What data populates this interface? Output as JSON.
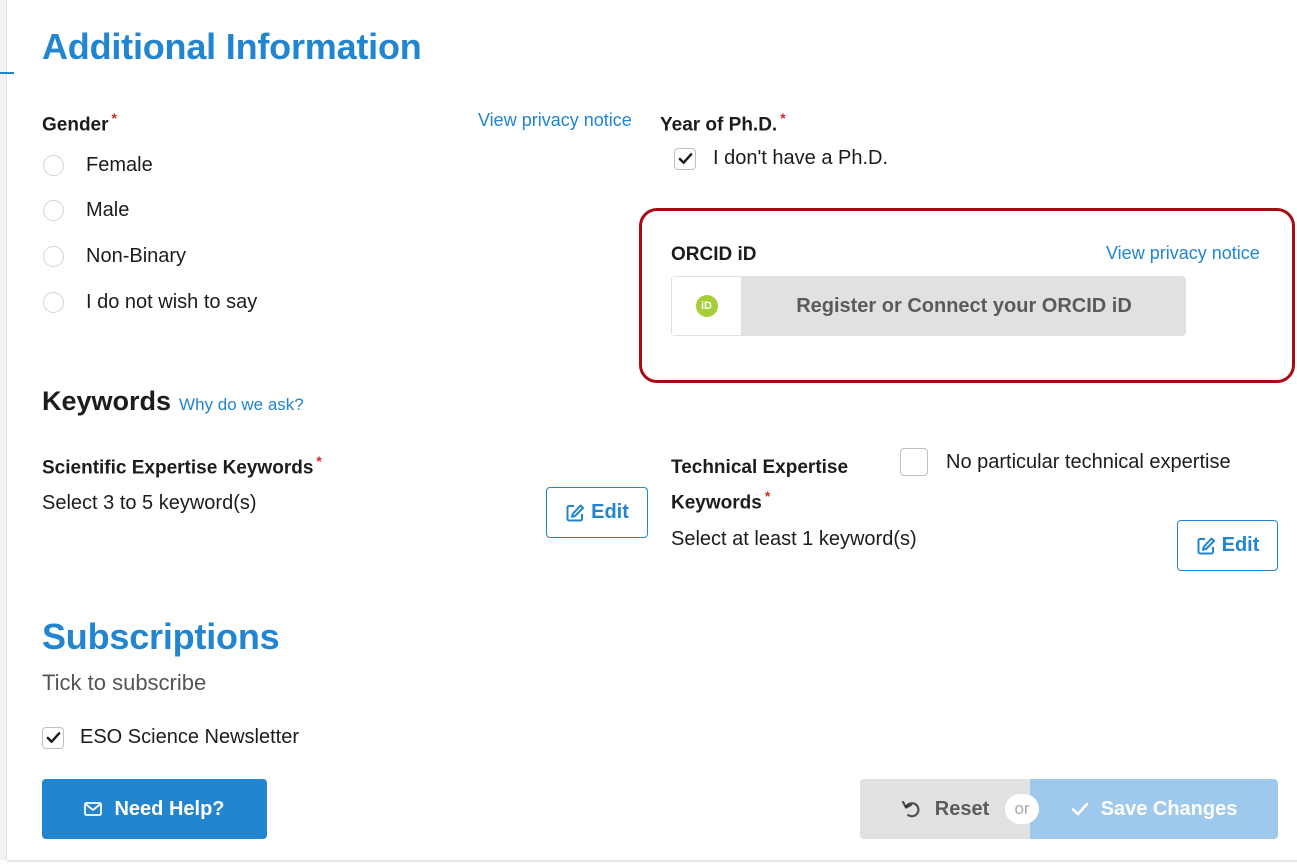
{
  "sections": {
    "additional_info": "Additional Information",
    "subscriptions": "Subscriptions"
  },
  "gender": {
    "label": "Gender",
    "required": "*",
    "privacy_link": "View privacy notice",
    "options": [
      "Female",
      "Male",
      "Non-Binary",
      "I do not wish to say"
    ]
  },
  "phd": {
    "label": "Year of Ph.D.",
    "required": "*",
    "no_phd_label": "I don't have a Ph.D.",
    "no_phd_checked": true
  },
  "orcid": {
    "label": "ORCID iD",
    "privacy_link": "View privacy notice",
    "icon_text": "iD",
    "button_label": "Register or Connect your ORCID iD"
  },
  "keywords": {
    "title": "Keywords",
    "why_link": "Why do we ask?",
    "scientific": {
      "label": "Scientific Expertise Keywords",
      "required": "*",
      "hint": "Select 3 to 5 keyword(s)",
      "edit_label": "Edit"
    },
    "technical": {
      "label_line1": "Technical Expertise",
      "label_line2": "Keywords",
      "required": "*",
      "hint": "Select at least 1 keyword(s)",
      "edit_label": "Edit",
      "none_label": "No particular technical expertise",
      "none_checked": false
    }
  },
  "subscriptions": {
    "subtitle": "Tick to subscribe",
    "newsletter_label": "ESO Science Newsletter",
    "newsletter_checked": true
  },
  "actions": {
    "help_label": "Need Help?",
    "reset_label": "Reset",
    "or_label": "or",
    "save_label": "Save Changes"
  },
  "icons": {
    "help": "envelope-icon",
    "reset": "undo-icon",
    "save": "check-icon",
    "edit": "edit-icon",
    "orcid": "orcid-icon"
  },
  "colors": {
    "accent": "#2185d0",
    "required": "#db2828",
    "highlight_frame": "#a60b16",
    "orcid_green": "#a6ce39",
    "save_disabled": "#9fc9ec"
  }
}
